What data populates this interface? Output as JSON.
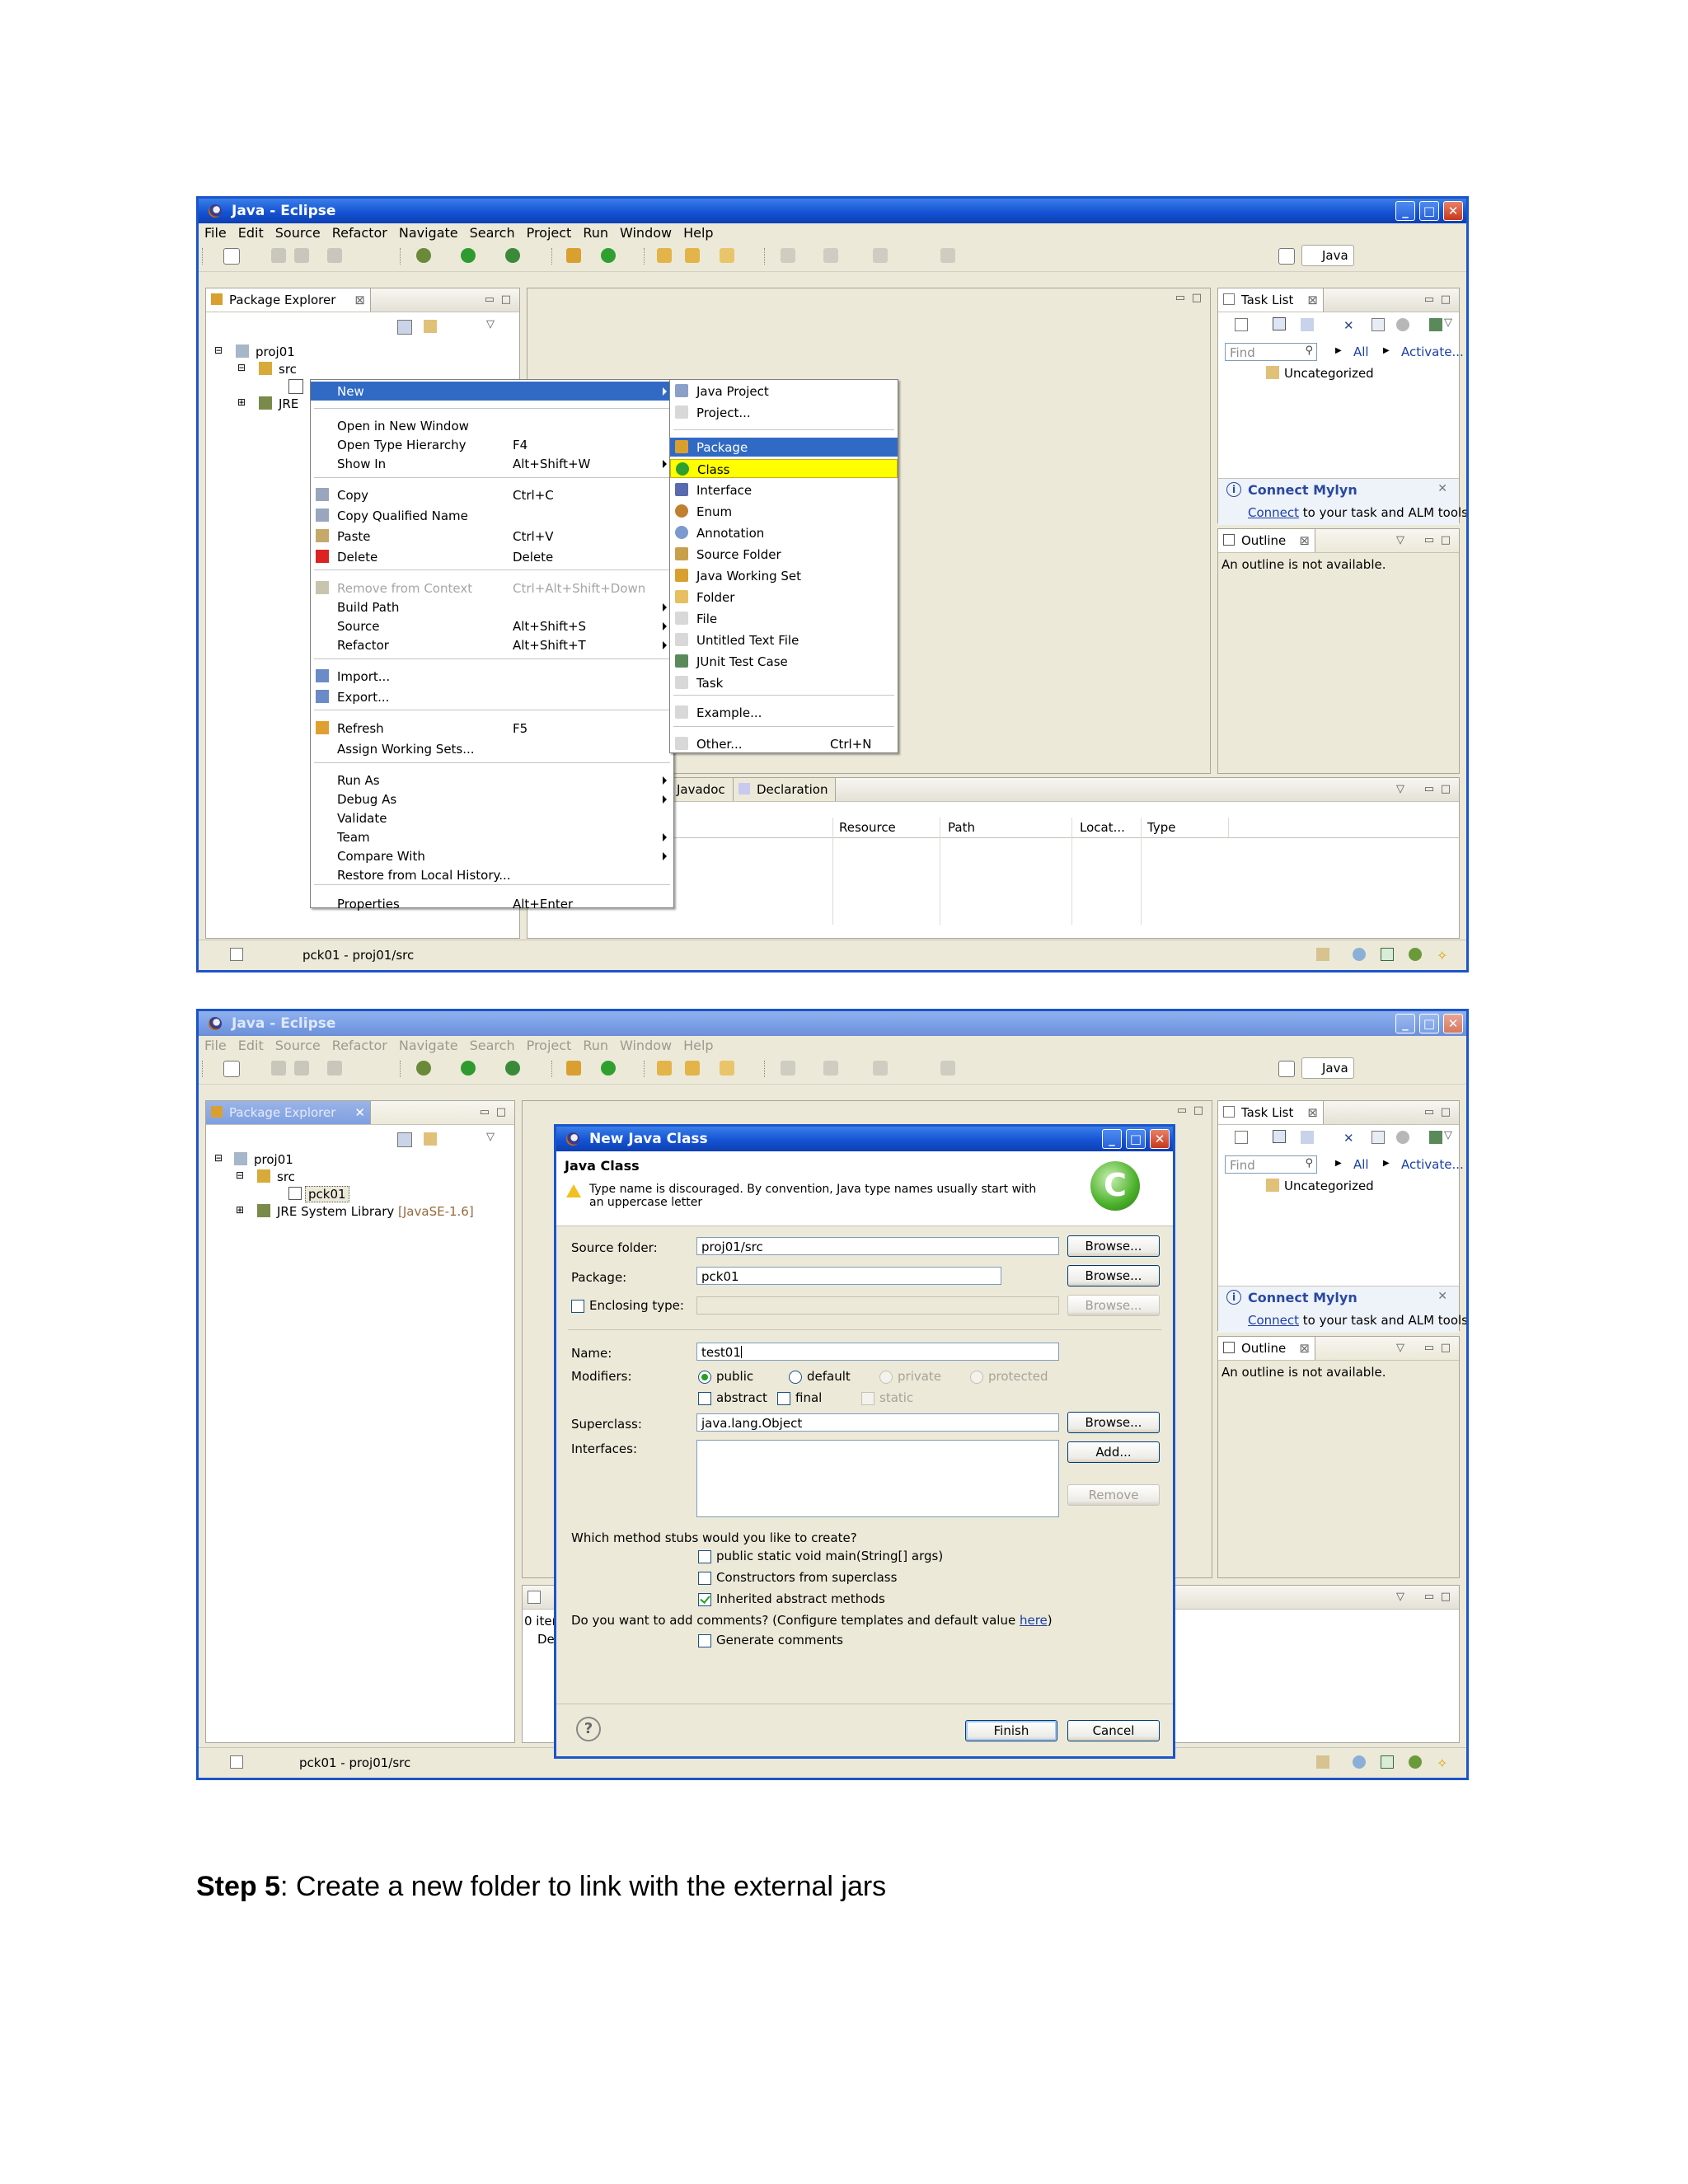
{
  "colors": {
    "xp_blue": "#1c55c9",
    "menu_select": "#316ac5",
    "highlight": "#ffff00",
    "face": "#ece9d8"
  },
  "s1": {
    "title": "Java - Eclipse",
    "menubar": [
      "File",
      "Edit",
      "Source",
      "Refactor",
      "Navigate",
      "Search",
      "Project",
      "Run",
      "Window",
      "Help"
    ],
    "perspective": "Java",
    "package_explorer": {
      "tab": "Package Explorer",
      "project": "proj01",
      "src": "src",
      "jre": "JRE"
    },
    "task_list": {
      "tab": "Task List",
      "find_placeholder": "Find",
      "all": "All",
      "activate": "Activate...",
      "uncategorized": "Uncategorized"
    },
    "mylyn": {
      "title": "Connect Mylyn",
      "link": "Connect",
      "rest": " to your task and ALM tools."
    },
    "outline": {
      "tab": "Outline",
      "message": "An outline is not available."
    },
    "bottom": {
      "tabs": [
        "Javadoc",
        "Declaration"
      ],
      "columns": [
        "Resource",
        "Path",
        "Locat...",
        "Type"
      ]
    },
    "status": "pck01 - proj01/src",
    "context_menu": [
      {
        "label": "New",
        "shortcut": "",
        "submenu": true,
        "selected": true
      },
      {
        "label": "Open in New Window",
        "shortcut": ""
      },
      {
        "label": "Open Type Hierarchy",
        "shortcut": "F4"
      },
      {
        "label": "Show In",
        "shortcut": "Alt+Shift+W",
        "submenu": true
      },
      {
        "label": "Copy",
        "shortcut": "Ctrl+C"
      },
      {
        "label": "Copy Qualified Name",
        "shortcut": ""
      },
      {
        "label": "Paste",
        "shortcut": "Ctrl+V"
      },
      {
        "label": "Delete",
        "shortcut": "Delete"
      },
      {
        "label": "Remove from Context",
        "shortcut": "Ctrl+Alt+Shift+Down",
        "disabled": true
      },
      {
        "label": "Build Path",
        "shortcut": "",
        "submenu": true
      },
      {
        "label": "Source",
        "shortcut": "Alt+Shift+S",
        "submenu": true
      },
      {
        "label": "Refactor",
        "shortcut": "Alt+Shift+T",
        "submenu": true
      },
      {
        "label": "Import...",
        "shortcut": ""
      },
      {
        "label": "Export...",
        "shortcut": ""
      },
      {
        "label": "Refresh",
        "shortcut": "F5"
      },
      {
        "label": "Assign Working Sets...",
        "shortcut": ""
      },
      {
        "label": "Run As",
        "shortcut": "",
        "submenu": true
      },
      {
        "label": "Debug As",
        "shortcut": "",
        "submenu": true
      },
      {
        "label": "Validate",
        "shortcut": ""
      },
      {
        "label": "Team",
        "shortcut": "",
        "submenu": true
      },
      {
        "label": "Compare With",
        "shortcut": "",
        "submenu": true
      },
      {
        "label": "Restore from Local History...",
        "shortcut": ""
      },
      {
        "label": "Properties",
        "shortcut": "Alt+Enter"
      }
    ],
    "new_submenu": [
      {
        "label": "Java Project"
      },
      {
        "label": "Project..."
      },
      {
        "label": "Package",
        "selected": true
      },
      {
        "label": "Class",
        "highlighted": true
      },
      {
        "label": "Interface"
      },
      {
        "label": "Enum"
      },
      {
        "label": "Annotation"
      },
      {
        "label": "Source Folder"
      },
      {
        "label": "Java Working Set"
      },
      {
        "label": "Folder"
      },
      {
        "label": "File"
      },
      {
        "label": "Untitled Text File"
      },
      {
        "label": "JUnit Test Case"
      },
      {
        "label": "Task"
      },
      {
        "label": "Example..."
      },
      {
        "label": "Other...",
        "shortcut": "Ctrl+N"
      }
    ]
  },
  "s2": {
    "title": "Java - Eclipse",
    "tree": {
      "project": "proj01",
      "src": "src",
      "package": "pck01",
      "jre": "JRE System Library",
      "jre_version": "[JavaSE-1.6]"
    },
    "bottom_fragments": [
      "0 iten",
      "De"
    ],
    "status": "pck01 - proj01/src",
    "dialog": {
      "title": "New Java Class",
      "heading": "Java Class",
      "warning_line1": "Type name is discouraged. By convention, Java type names usually start with",
      "warning_line2": "an uppercase letter",
      "source_folder_label": "Source folder:",
      "source_folder": "proj01/src",
      "package_label": "Package:",
      "package": "pck01",
      "enclosing_label": "Enclosing type:",
      "name_label": "Name:",
      "name": "test01",
      "modifiers_label": "Modifiers:",
      "mod_public": "public",
      "mod_default": "default",
      "mod_private": "private",
      "mod_protected": "protected",
      "mod_abstract": "abstract",
      "mod_final": "final",
      "mod_static": "static",
      "superclass_label": "Superclass:",
      "superclass": "java.lang.Object",
      "interfaces_label": "Interfaces:",
      "browse": "Browse...",
      "add": "Add...",
      "remove": "Remove",
      "stubs_question": "Which method stubs would you like to create?",
      "stub_main": "public static void main(String[] args)",
      "stub_ctor": "Constructors from superclass",
      "stub_inherited": "Inherited abstract methods",
      "comments_question_pre": "Do you want to add comments? (Configure templates and default value ",
      "comments_link": "here",
      "comments_question_post": ")",
      "generate_comments": "Generate comments",
      "finish": "Finish",
      "cancel": "Cancel"
    }
  },
  "caption": {
    "bold": "Step 5",
    "rest": ": Create a new folder to link with the external jars"
  }
}
